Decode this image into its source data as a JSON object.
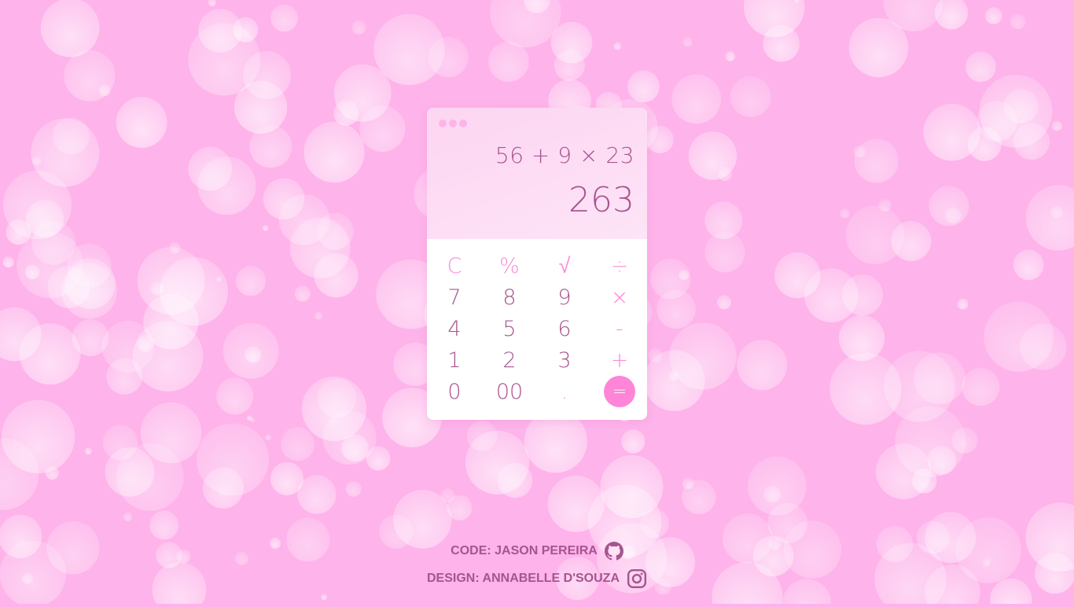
{
  "calculator": {
    "expression": "56 + 9 × 23",
    "result": "263",
    "keys": [
      {
        "label": "C",
        "type": "op"
      },
      {
        "label": "%",
        "type": "op"
      },
      {
        "label": "√",
        "type": "op"
      },
      {
        "label": "÷",
        "type": "op"
      },
      {
        "label": "7",
        "type": "num"
      },
      {
        "label": "8",
        "type": "num"
      },
      {
        "label": "9",
        "type": "num"
      },
      {
        "label": "×",
        "type": "op"
      },
      {
        "label": "4",
        "type": "num"
      },
      {
        "label": "5",
        "type": "num"
      },
      {
        "label": "6",
        "type": "num"
      },
      {
        "label": "-",
        "type": "op"
      },
      {
        "label": "1",
        "type": "num"
      },
      {
        "label": "2",
        "type": "num"
      },
      {
        "label": "3",
        "type": "num"
      },
      {
        "label": "+",
        "type": "op"
      },
      {
        "label": "0",
        "type": "num"
      },
      {
        "label": "00",
        "type": "num"
      },
      {
        "label": ".",
        "type": "op"
      },
      {
        "label": "=",
        "type": "eq"
      }
    ]
  },
  "footer": {
    "code_credit": "CODE: JASON PEREIRA",
    "code_icon": "github-icon",
    "design_credit": "DESIGN: ANNABELLE D'SOUZA",
    "design_icon": "instagram-icon"
  },
  "colors": {
    "background": "#feb3ea",
    "accent": "#fe85d8",
    "text": "#a9568f"
  }
}
